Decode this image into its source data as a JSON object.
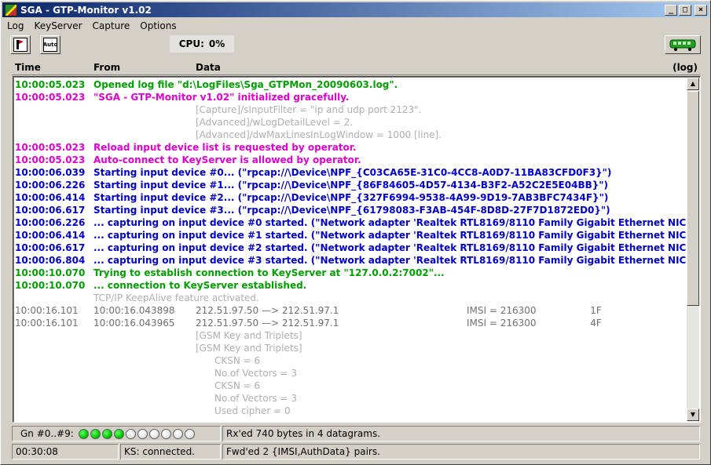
{
  "window": {
    "title": "SGA - GTP-Monitor  v1.02"
  },
  "menu": [
    "Log",
    "KeyServer",
    "Capture",
    "Options"
  ],
  "toolbar": {
    "filter_icon": "filter-icon",
    "auto_label": "Auto",
    "cpu_label": "CPU:",
    "cpu_value": "0%",
    "connection_icon": "train-icon"
  },
  "columns": {
    "time": "Time",
    "from": "From",
    "data": "Data",
    "log": "(log)"
  },
  "colors": {
    "green": "#00a000",
    "magenta": "#e000d0",
    "blue": "#0000cc",
    "gray": "#b0b0b0",
    "dark_gray": "#707070"
  },
  "log_rows": [
    {
      "time": "10:00:05.023",
      "from": "",
      "data": "Opened log file \"d:\\LogFiles\\Sga_GTPMon_20090603.log\".",
      "color": "green",
      "mode": "span"
    },
    {
      "time": "10:00:05.023",
      "from": "",
      "data": "\"SGA - GTP-Monitor  v1.02\" initialized gracefully.",
      "color": "magenta",
      "mode": "span"
    },
    {
      "time": "",
      "from": "",
      "data": "[Capture]/sInputFilter = \"ip and udp port 2123\".",
      "color": "gray",
      "mode": "indent1"
    },
    {
      "time": "",
      "from": "",
      "data": "[Advanced]/wLogDetailLevel = 2.",
      "color": "gray",
      "mode": "indent1"
    },
    {
      "time": "",
      "from": "",
      "data": "[Advanced]/dwMaxLinesInLogWindow = 1000 [line].",
      "color": "gray",
      "mode": "indent1"
    },
    {
      "time": "10:00:05.023",
      "from": "",
      "data": "Reload input device list is requested by operator.",
      "color": "magenta",
      "mode": "span"
    },
    {
      "time": "10:00:05.023",
      "from": "",
      "data": "Auto-connect to KeyServer is allowed by operator.",
      "color": "magenta",
      "mode": "span"
    },
    {
      "time": "10:00:06.039",
      "from": "",
      "data": "Starting input device #0...  (\"rpcap://\\Device\\NPF_{C03CA65E-31C0-4CC8-A0D7-11BA83CFD0F3}\")",
      "color": "blue",
      "mode": "span"
    },
    {
      "time": "10:00:06.226",
      "from": "",
      "data": "Starting input device #1...  (\"rpcap://\\Device\\NPF_{86F84605-4D57-4134-B3F2-A52C2E5E04BB}\")",
      "color": "blue",
      "mode": "span"
    },
    {
      "time": "10:00:06.414",
      "from": "",
      "data": "Starting input device #2...  (\"rpcap://\\Device\\NPF_{327F6994-9538-4A99-9D19-7AB3BFC7434F}\")",
      "color": "blue",
      "mode": "span"
    },
    {
      "time": "10:00:06.617",
      "from": "",
      "data": "Starting input device #3...  (\"rpcap://\\Device\\NPF_{61798083-F3AB-454F-8D8D-27F7D1872ED0}\")",
      "color": "blue",
      "mode": "span"
    },
    {
      "time": "10:00:06.226",
      "from": "",
      "data": "... capturing on input device #0 started.  (\"Network adapter 'Realtek RTL8169/8110 Family Gigabit Ethernet NIC",
      "color": "blue",
      "mode": "span"
    },
    {
      "time": "10:00:06.414",
      "from": "",
      "data": "... capturing on input device #1 started.  (\"Network adapter 'Realtek RTL8169/8110 Family Gigabit Ethernet NIC",
      "color": "blue",
      "mode": "span"
    },
    {
      "time": "10:00:06.617",
      "from": "",
      "data": "... capturing on input device #2 started.  (\"Network adapter 'Realtek RTL8169/8110 Family Gigabit Ethernet NIC",
      "color": "blue",
      "mode": "span"
    },
    {
      "time": "10:00:06.804",
      "from": "",
      "data": "... capturing on input device #3 started.  (\"Network adapter 'Realtek RTL8169/8110 Family Gigabit Ethernet NIC",
      "color": "blue",
      "mode": "span"
    },
    {
      "time": "10:00:10.070",
      "from": "",
      "data": "Trying to establish connection to KeyServer at \"127.0.0.2:7002\"...",
      "color": "green",
      "mode": "span"
    },
    {
      "time": "10:00:10.070",
      "from": "",
      "data": "... connection to KeyServer established.",
      "color": "green",
      "mode": "span"
    },
    {
      "time": "",
      "from": "",
      "data": "TCP/IP KeepAlive feature activated.",
      "color": "gray",
      "mode": "span"
    },
    {
      "time": "10:00:16.101",
      "from": "10:00:16.043898",
      "data": "212.51.97.50  —>  212.51.97.1",
      "imsi": "IMSI = 216300         1F",
      "color": "dark_gray",
      "mode": "packet"
    },
    {
      "time": "10:00:16.101",
      "from": "10:00:16.043965",
      "data": "212.51.97.50  —>  212.51.97.1",
      "imsi": "IMSI = 216300         4F",
      "color": "dark_gray",
      "mode": "packet"
    },
    {
      "time": "",
      "from": "",
      "data": "[GSM Key and Triplets]",
      "color": "gray",
      "mode": "indent1"
    },
    {
      "time": "",
      "from": "",
      "data": "[GSM Key and Triplets]",
      "color": "gray",
      "mode": "indent1"
    },
    {
      "time": "",
      "from": "",
      "data": "CKSN = 6",
      "color": "gray",
      "mode": "indent2"
    },
    {
      "time": "",
      "from": "",
      "data": "No.of Vectors = 3",
      "color": "gray",
      "mode": "indent2"
    },
    {
      "time": "",
      "from": "",
      "data": "CKSN = 6",
      "color": "gray",
      "mode": "indent2"
    },
    {
      "time": "",
      "from": "",
      "data": "No.of Vectors = 3",
      "color": "gray",
      "mode": "indent2"
    },
    {
      "time": "",
      "from": "",
      "data": "Used cipher = 0",
      "color": "gray",
      "mode": "indent2"
    }
  ],
  "status": {
    "gn_label": "Gn #0..#9:",
    "leds": [
      true,
      true,
      true,
      true,
      false,
      false,
      false,
      false,
      false,
      false
    ],
    "rx_text": "Rx'ed 740 bytes in 4 datagrams.",
    "elapsed": "00:30:08",
    "ks_text": "KS: connected.",
    "fwd_text": "Fwd'ed 2 {IMSI,AuthData} pairs."
  }
}
